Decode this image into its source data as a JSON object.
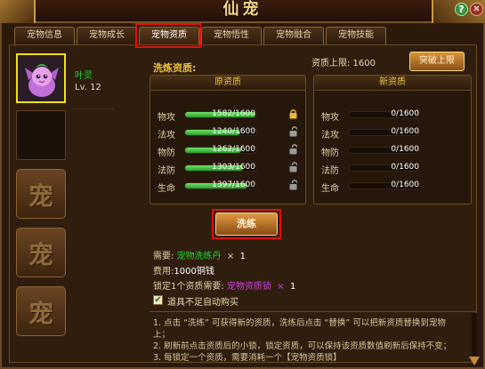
{
  "window": {
    "title": "仙宠"
  },
  "tabs": [
    {
      "label": "宠物信息",
      "active": false
    },
    {
      "label": "宠物成长",
      "active": false
    },
    {
      "label": "宠物资质",
      "active": true
    },
    {
      "label": "宠物悟性",
      "active": false
    },
    {
      "label": "宠物融合",
      "active": false
    },
    {
      "label": "宠物技能",
      "active": false
    }
  ],
  "pet_list": {
    "selected": {
      "name": "叶灵",
      "level": "Lv. 12"
    },
    "locked_slot_glyph": "宠"
  },
  "wash": {
    "section_title": "洗炼资质:",
    "limit_label": "资质上限: 1600",
    "breakthrough_label": "突破上限",
    "original_header": "原资质",
    "new_header": "新资质",
    "max": 1600,
    "original_stats": [
      {
        "label": "物攻",
        "value": 1582,
        "text": "1582/1600",
        "locked": true
      },
      {
        "label": "法攻",
        "value": 1240,
        "text": "1240/1600",
        "locked": false
      },
      {
        "label": "物防",
        "value": 1262,
        "text": "1262/1600",
        "locked": false
      },
      {
        "label": "法防",
        "value": 1303,
        "text": "1303/1600",
        "locked": false
      },
      {
        "label": "生命",
        "value": 1397,
        "text": "1397/1600",
        "locked": false
      }
    ],
    "new_stats": [
      {
        "label": "物攻",
        "value": 0,
        "text": "0/1600"
      },
      {
        "label": "法攻",
        "value": 0,
        "text": "0/1600"
      },
      {
        "label": "物防",
        "value": 0,
        "text": "0/1600"
      },
      {
        "label": "法防",
        "value": 0,
        "text": "0/1600"
      },
      {
        "label": "生命",
        "value": 0,
        "text": "0/1600"
      }
    ],
    "wash_button": "洗练"
  },
  "requirements": {
    "need_label": "需要:",
    "need_item": "宠物洗练丹",
    "need_times": "×",
    "need_count": "1",
    "cost_label": "费用:",
    "cost_value": "1000铜钱",
    "lock_label": "锁定1个资质需要:",
    "lock_item": "宠物资质锁",
    "lock_times": "×",
    "lock_count": "1",
    "auto_buy_label": "道具不足自动购买",
    "auto_buy_checked": true
  },
  "hints": [
    "1. 点击 “洗练” 可获得新的资质，洗练后点击 “替换” 可以把新资质替换到宠物",
    "上；",
    "2. 刷新前点击资质后的小锁，锁定资质，可以保持该资质数值刷新后保持不变；",
    "3. 每锁定一个资质，需要消耗一个【宠物资质锁】"
  ],
  "colors": {
    "accent_gold": "#f0c43c",
    "bar_green": "#2a9d28",
    "highlight_red": "#e01010",
    "item_green": "#28d12e",
    "item_purple": "#d03ae6"
  }
}
